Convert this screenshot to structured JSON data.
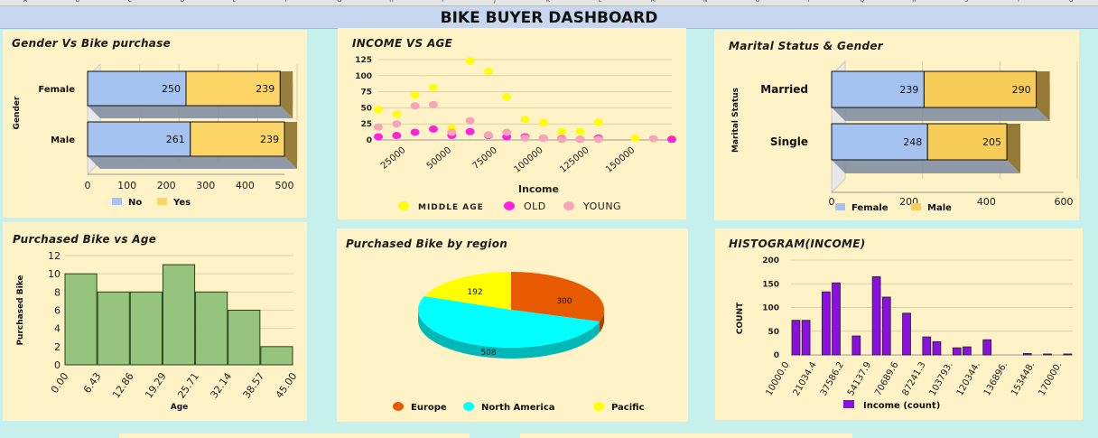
{
  "dashboard": {
    "title": "BIKE BUYER DASHBOARD"
  },
  "column_headers": [
    "A",
    "B",
    "C",
    "D",
    "E",
    "F",
    "G",
    "H",
    "I",
    "J",
    "K",
    "L",
    "M",
    "N",
    "O",
    "P",
    "Q",
    "R",
    "S",
    "T",
    "U"
  ],
  "colors": {
    "no": "#a6c2f0",
    "yes": "#fdd466",
    "female": "#a6c2f0",
    "male": "#f8cc58",
    "middle_age": "#ffff00",
    "old": "#ff22dd",
    "young": "#f4a6b8",
    "europe": "#e85a00",
    "north_america": "#00ffff",
    "pacific": "#ffff00",
    "age_bar": "#96c47e",
    "histogram": "#8b10e0"
  },
  "chart_data": [
    {
      "id": "gender_vs_bike",
      "type": "bar",
      "orientation": "horizontal",
      "stacked": true,
      "title": "Gender Vs Bike purchase",
      "ylabel": "Gender",
      "categories": [
        "Female",
        "Male"
      ],
      "series": [
        {
          "name": "No",
          "values": [
            250,
            261
          ]
        },
        {
          "name": "Yes",
          "values": [
            239,
            239
          ]
        }
      ],
      "xlim": [
        0,
        500
      ],
      "xticks": [
        0,
        100,
        200,
        300,
        400,
        500
      ],
      "legend": "bottom"
    },
    {
      "id": "income_vs_age",
      "type": "scatter",
      "title": "INCOME VS AGE",
      "xlabel": "Income",
      "xlim": [
        10000,
        170000
      ],
      "ylim": [
        0,
        125
      ],
      "xticks": [
        25000,
        50000,
        75000,
        100000,
        125000,
        150000
      ],
      "yticks": [
        0,
        25,
        50,
        75,
        100,
        125
      ],
      "series": [
        {
          "name": "MIDDLE AGE",
          "points": [
            [
              10000,
              47
            ],
            [
              20000,
              40
            ],
            [
              30000,
              70
            ],
            [
              40000,
              82
            ],
            [
              50000,
              18
            ],
            [
              60000,
              123
            ],
            [
              70000,
              107
            ],
            [
              80000,
              67
            ],
            [
              90000,
              32
            ],
            [
              100000,
              27
            ],
            [
              110000,
              13
            ],
            [
              120000,
              13
            ],
            [
              130000,
              28
            ],
            [
              150000,
              3
            ],
            [
              170000,
              2
            ]
          ]
        },
        {
          "name": "OLD",
          "points": [
            [
              10000,
              5
            ],
            [
              20000,
              7
            ],
            [
              30000,
              12
            ],
            [
              40000,
              17
            ],
            [
              50000,
              7
            ],
            [
              60000,
              13
            ],
            [
              70000,
              7
            ],
            [
              80000,
              5
            ],
            [
              90000,
              5
            ],
            [
              100000,
              3
            ],
            [
              110000,
              2
            ],
            [
              120000,
              1
            ],
            [
              130000,
              3
            ],
            [
              170000,
              1
            ]
          ]
        },
        {
          "name": "YOUNG",
          "points": [
            [
              10000,
              20
            ],
            [
              20000,
              25
            ],
            [
              30000,
              53
            ],
            [
              40000,
              55
            ],
            [
              50000,
              12
            ],
            [
              60000,
              30
            ],
            [
              70000,
              8
            ],
            [
              80000,
              12
            ],
            [
              90000,
              3
            ],
            [
              100000,
              3
            ],
            [
              110000,
              1
            ],
            [
              120000,
              1
            ],
            [
              130000,
              1
            ],
            [
              160000,
              2
            ]
          ]
        }
      ],
      "legend": "bottom"
    },
    {
      "id": "marital_gender",
      "type": "bar",
      "orientation": "horizontal",
      "stacked": true,
      "title": "Marital Status & Gender",
      "ylabel": "Marital Status",
      "categories": [
        "Married",
        "Single"
      ],
      "series": [
        {
          "name": "Female",
          "values": [
            239,
            248
          ]
        },
        {
          "name": "Male",
          "values": [
            290,
            205
          ]
        }
      ],
      "xlim": [
        0,
        600
      ],
      "xticks": [
        0,
        200,
        400,
        600
      ],
      "legend": "bottom"
    },
    {
      "id": "purchased_vs_age",
      "type": "bar",
      "title": "Purchased Bike vs Age",
      "xlabel": "Age",
      "ylabel": "Purchased Bike",
      "x_edges": [
        "0.00",
        "6.43",
        "12.86",
        "19.29",
        "25.71",
        "32.14",
        "38.57",
        "45.00"
      ],
      "values": [
        10,
        8,
        8,
        11,
        8,
        6,
        2
      ],
      "ylim": [
        0,
        12
      ],
      "yticks": [
        0,
        2,
        4,
        6,
        8,
        10,
        12
      ]
    },
    {
      "id": "bike_by_region",
      "type": "pie",
      "title": "Purchased Bike by region",
      "categories": [
        "Europe",
        "North America",
        "Pacific"
      ],
      "values": [
        300,
        508,
        192
      ],
      "legend": "bottom"
    },
    {
      "id": "histogram_income",
      "type": "bar",
      "title": "HISTOGRAM(INCOME)",
      "ylabel": "COUNT",
      "categories": [
        "10000.0",
        "21034.4",
        "37586.2",
        "54137.9",
        "70689.6",
        "87241.3",
        "103793.",
        "120344.",
        "136896.",
        "153448.",
        "170000."
      ],
      "values": [
        73,
        73,
        0,
        133,
        152,
        0,
        40,
        0,
        165,
        122,
        0,
        88,
        0,
        38,
        28,
        0,
        15,
        17,
        0,
        32,
        0,
        0,
        0,
        3,
        0,
        2,
        0,
        2
      ],
      "ylim": [
        0,
        200
      ],
      "yticks": [
        0,
        50,
        100,
        150,
        200
      ],
      "series_name": "Income (count)",
      "legend": "bottom"
    }
  ]
}
